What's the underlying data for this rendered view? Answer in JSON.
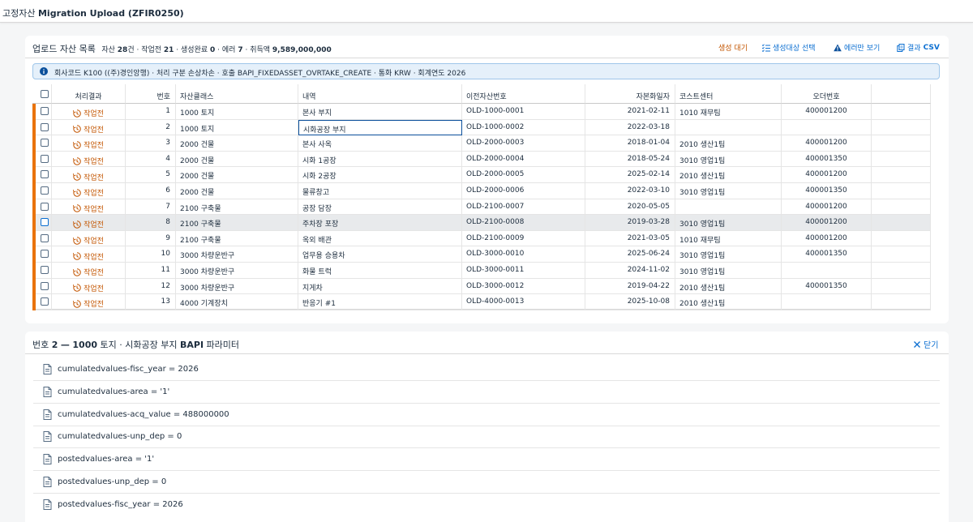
{
  "shell": {
    "title_prefix": "고정자산",
    "title_bold": "Migration Upload (ZFIR0250)"
  },
  "list": {
    "title": "업로드 자산 목록",
    "summary": {
      "assets_label": "자산",
      "assets_count": "28",
      "assets_unit": "건",
      "sep1": " · ",
      "pending_label": "작업전",
      "pending_count": "21",
      "sep2": " · ",
      "created_label": "생성완료",
      "created_count": "0",
      "sep3": " · ",
      "error_label": "에러",
      "error_count": "7",
      "sep4": " · ",
      "amount_label": "취득액",
      "amount_value": "9,589,000,000"
    },
    "toolbar": {
      "pending": "생성 대기",
      "select": "생성대상 선택",
      "errors_only": "에러만 보기",
      "csv_prefix": "결과",
      "csv_bold": "CSV"
    },
    "info": "회사코드 K100 ((주)경인앙행) · 처리 구분 손상차손 · 호출 BAPI_FIXEDASSET_OVRTAKE_CREATE · 통화 KRW · 회계연도 2026",
    "columns": {
      "status": "처리결과",
      "no": "번호",
      "class": "자산클래스",
      "desc": "내역",
      "old": "이전자산번호",
      "date": "자본화일자",
      "cc": "코스트센터",
      "order": "오더번호"
    },
    "rows": [
      {
        "status": "작업전",
        "no": "1",
        "class": "1000 토지",
        "desc": "본사 부지",
        "old": "OLD-1000-0001",
        "date": "2021-02-11",
        "cc": "1010 재무팀",
        "order": "400001200"
      },
      {
        "status": "작업전",
        "no": "2",
        "class": "1000 토지",
        "desc": "시화공장 부지",
        "old": "OLD-1000-0002",
        "date": "2022-03-18",
        "cc": "",
        "order": ""
      },
      {
        "status": "작업전",
        "no": "3",
        "class": "2000 건물",
        "desc": "본사 사옥",
        "old": "OLD-2000-0003",
        "date": "2018-01-04",
        "cc": "2010 생산1팀",
        "order": "400001200"
      },
      {
        "status": "작업전",
        "no": "4",
        "class": "2000 건물",
        "desc": "시화 1공장",
        "old": "OLD-2000-0004",
        "date": "2018-05-24",
        "cc": "3010 영업1팀",
        "order": "400001350"
      },
      {
        "status": "작업전",
        "no": "5",
        "class": "2000 건물",
        "desc": "시화 2공장",
        "old": "OLD-2000-0005",
        "date": "2025-02-14",
        "cc": "2010 생산1팀",
        "order": "400001200"
      },
      {
        "status": "작업전",
        "no": "6",
        "class": "2000 건물",
        "desc": "물류창고",
        "old": "OLD-2000-0006",
        "date": "2022-03-10",
        "cc": "3010 영업1팀",
        "order": "400001350"
      },
      {
        "status": "작업전",
        "no": "7",
        "class": "2100 구축물",
        "desc": "공장 담장",
        "old": "OLD-2100-0007",
        "date": "2020-05-05",
        "cc": "",
        "order": "400001200"
      },
      {
        "status": "작업전",
        "no": "8",
        "class": "2100 구축물",
        "desc": "주차장 포장",
        "old": "OLD-2100-0008",
        "date": "2019-03-28",
        "cc": "3010 영업1팀",
        "order": "400001200"
      },
      {
        "status": "작업전",
        "no": "9",
        "class": "2100 구축물",
        "desc": "옥외 배관",
        "old": "OLD-2100-0009",
        "date": "2021-03-05",
        "cc": "1010 재무팀",
        "order": "400001200"
      },
      {
        "status": "작업전",
        "no": "10",
        "class": "3000 차량운반구",
        "desc": "업무용 승용차",
        "old": "OLD-3000-0010",
        "date": "2025-06-24",
        "cc": "3010 영업1팀",
        "order": "400001350"
      },
      {
        "status": "작업전",
        "no": "11",
        "class": "3000 차량운반구",
        "desc": "화물 트럭",
        "old": "OLD-3000-0011",
        "date": "2024-11-02",
        "cc": "3010 영업1팀",
        "order": ""
      },
      {
        "status": "작업전",
        "no": "12",
        "class": "3000 차량운반구",
        "desc": "지게차",
        "old": "OLD-3000-0012",
        "date": "2019-04-22",
        "cc": "2010 생산1팀",
        "order": "400001350"
      },
      {
        "status": "작업전",
        "no": "13",
        "class": "4000 기계장치",
        "desc": "반응기 #1",
        "old": "OLD-4000-0013",
        "date": "2025-10-08",
        "cc": "2010 생산1팀",
        "order": ""
      }
    ]
  },
  "params": {
    "title_prefix": "번호",
    "title_no": "2",
    "title_dash": "—",
    "title_class": "1000",
    "title_rest": "토지 · 시화공장 부지",
    "title_bapi": "BAPI",
    "title_suffix": "파라미터",
    "close": "닫기",
    "items": [
      "cumulatedvalues-fisc_year = 2026",
      "cumulatedvalues-area = '1'",
      "cumulatedvalues-acq_value = 488000000",
      "cumulatedvalues-unp_dep = 0",
      "postedvalues-area = '1'",
      "postedvalues-unp_dep = 0",
      "postedvalues-fisc_year = 2026"
    ]
  },
  "colors": {
    "accent": "#0a6ed1",
    "warning": "#e9730c",
    "warning_text": "#c35500"
  }
}
